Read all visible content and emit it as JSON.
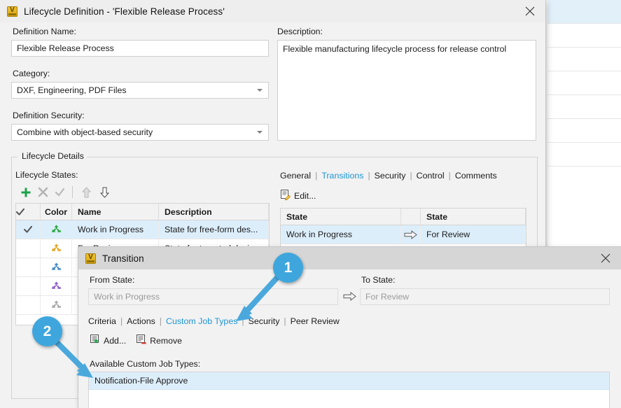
{
  "background": {
    "selected_row_index": 0,
    "row_count": 7
  },
  "lifecycle_dialog": {
    "title": "Lifecycle Definition - 'Flexible Release Process'",
    "icon": "vault-app-icon",
    "close_icon": "close-icon",
    "definition_name_label": "Definition Name:",
    "definition_name_value": "Flexible Release Process",
    "category_label": "Category:",
    "category_value": "DXF, Engineering, PDF Files",
    "definition_security_label": "Definition Security:",
    "definition_security_value": "Combine with object-based security",
    "description_label": "Description:",
    "description_value": "Flexible manufacturing lifecycle process for release control",
    "details_group_title": "Lifecycle Details",
    "states_label": "Lifecycle States:",
    "states_toolbar": [
      {
        "name": "add-state-button",
        "glyph": "plus",
        "color": "#1aa24a",
        "enabled": true
      },
      {
        "name": "delete-state-button",
        "glyph": "cross",
        "color": "#b4b4b4",
        "enabled": false
      },
      {
        "name": "set-default-state-button",
        "glyph": "check",
        "color": "#b8b8b8",
        "enabled": false
      },
      {
        "name": "move-state-up-button",
        "glyph": "arrow-up",
        "color": "#bdbdbd",
        "enabled": false
      },
      {
        "name": "move-state-down-button",
        "glyph": "arrow-down",
        "color": "#545454",
        "enabled": true
      }
    ],
    "states_table": {
      "columns": [
        "",
        "Color",
        "Name",
        "Description"
      ],
      "check_header_icon": "check-icon",
      "rows": [
        {
          "checked": true,
          "color": "#24a83a",
          "name": "Work in Progress",
          "description": "State for free-form des..."
        },
        {
          "checked": false,
          "color": "#e3a019",
          "name": "For Review",
          "description": "State for targeted desi"
        },
        {
          "checked": false,
          "color": "#3c86c8",
          "name": "",
          "description": ""
        },
        {
          "checked": false,
          "color": "#8a5bc8",
          "name": "",
          "description": ""
        },
        {
          "checked": false,
          "color": "#a6a6a6",
          "name": "",
          "description": ""
        }
      ]
    },
    "detail_tabs": [
      {
        "label": "General",
        "active": false
      },
      {
        "label": "Transitions",
        "active": true
      },
      {
        "label": "Security",
        "active": false
      },
      {
        "label": "Control",
        "active": false
      },
      {
        "label": "Comments",
        "active": false
      }
    ],
    "edit_button": {
      "label": "Edit...",
      "icon": "edit-document-icon"
    },
    "transitions_table": {
      "columns": [
        "State",
        "",
        "State"
      ],
      "rows": [
        {
          "from": "Work in Progress",
          "arrow": "right-arrow-icon",
          "to": "For Review"
        }
      ]
    }
  },
  "transition_dialog": {
    "title": "Transition",
    "icon": "vault-app-icon",
    "close_icon": "close-icon",
    "from_state_label": "From State:",
    "from_state_value": "Work in Progress",
    "to_state_label": "To State:",
    "to_state_value": "For Review",
    "arrow_icon": "right-arrow-icon",
    "tabs": [
      {
        "label": "Criteria",
        "active": false
      },
      {
        "label": "Actions",
        "active": false
      },
      {
        "label": "Custom Job Types",
        "active": true
      },
      {
        "label": "Security",
        "active": false
      },
      {
        "label": "Peer Review",
        "active": false
      }
    ],
    "toolbar": [
      {
        "label": "Add...",
        "icon": "add-list-icon"
      },
      {
        "label": "Remove",
        "icon": "remove-list-icon"
      }
    ],
    "available_label": "Available Custom Job Types:",
    "available_items": [
      {
        "label": "Notification-File Approve",
        "selected": true
      }
    ]
  },
  "callouts": [
    {
      "number": "1",
      "color": "#3ea6dd",
      "target": "custom-job-types-tab"
    },
    {
      "number": "2",
      "color": "#3ea6dd",
      "target": "available-custom-job-types-list"
    }
  ]
}
